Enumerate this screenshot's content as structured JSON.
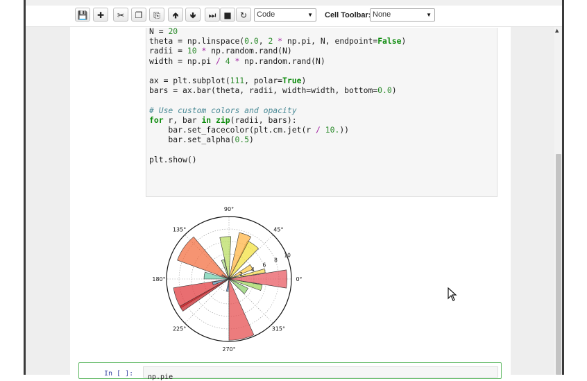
{
  "toolbar": {
    "buttons": [
      {
        "name": "save-button",
        "icon": "save-icon",
        "glyph": "💾"
      },
      {
        "name": "insert-cell-button",
        "icon": "plus-icon",
        "glyph": "✚"
      },
      {
        "name": "cut-button",
        "icon": "scissors-icon",
        "glyph": "✂"
      },
      {
        "name": "copy-button",
        "icon": "copy-icon",
        "glyph": "❐"
      },
      {
        "name": "paste-button",
        "icon": "paste-icon",
        "glyph": "⎘"
      },
      {
        "name": "move-up-button",
        "icon": "arrow-up-icon",
        "glyph": "🢁"
      },
      {
        "name": "move-down-button",
        "icon": "arrow-down-icon",
        "glyph": "🢃"
      },
      {
        "name": "run-button",
        "icon": "step-forward-icon",
        "glyph": "⏭"
      },
      {
        "name": "interrupt-button",
        "icon": "stop-icon",
        "glyph": "■"
      },
      {
        "name": "restart-button",
        "icon": "refresh-icon",
        "glyph": "↻"
      }
    ],
    "cell_type": "Code",
    "cell_toolbar_label": "Cell Toolbar:",
    "cell_toolbar_value": "None"
  },
  "code_lines": [
    [
      {
        "t": "N = "
      },
      {
        "t": "20",
        "c": "num"
      }
    ],
    [
      {
        "t": "theta = np.linspace("
      },
      {
        "t": "0.0",
        "c": "num"
      },
      {
        "t": ", "
      },
      {
        "t": "2",
        "c": "num"
      },
      {
        "t": " "
      },
      {
        "t": "*",
        "c": "op"
      },
      {
        "t": " np.pi, N, endpoint="
      },
      {
        "t": "False",
        "c": "kw"
      },
      {
        "t": ")"
      }
    ],
    [
      {
        "t": "radii = "
      },
      {
        "t": "10",
        "c": "num"
      },
      {
        "t": " "
      },
      {
        "t": "*",
        "c": "op"
      },
      {
        "t": " np.random.rand(N)"
      }
    ],
    [
      {
        "t": "width = np.pi "
      },
      {
        "t": "/",
        "c": "op"
      },
      {
        "t": " "
      },
      {
        "t": "4",
        "c": "num"
      },
      {
        "t": " "
      },
      {
        "t": "*",
        "c": "op"
      },
      {
        "t": " np.random.rand(N)"
      }
    ],
    [],
    [
      {
        "t": "ax = plt.subplot("
      },
      {
        "t": "111",
        "c": "num"
      },
      {
        "t": ", polar="
      },
      {
        "t": "True",
        "c": "kw"
      },
      {
        "t": ")"
      }
    ],
    [
      {
        "t": "bars = ax.bar(theta, radii, width=width, bottom="
      },
      {
        "t": "0.0",
        "c": "num"
      },
      {
        "t": ")"
      }
    ],
    [],
    [
      {
        "t": "# Use custom colors and opacity",
        "c": "cm"
      }
    ],
    [
      {
        "t": "for",
        "c": "kw"
      },
      {
        "t": " r, bar "
      },
      {
        "t": "in",
        "c": "kw"
      },
      {
        "t": " "
      },
      {
        "t": "zip",
        "c": "kw"
      },
      {
        "t": "(radii, bars):"
      }
    ],
    [
      {
        "t": "    bar.set_facecolor(plt.cm.jet(r "
      },
      {
        "t": "/",
        "c": "op"
      },
      {
        "t": " "
      },
      {
        "t": "10.",
        "c": "num"
      },
      {
        "t": "))"
      }
    ],
    [
      {
        "t": "    bar.set_alpha("
      },
      {
        "t": "0.5",
        "c": "num"
      },
      {
        "t": ")"
      }
    ],
    [],
    [
      {
        "t": "plt.show()"
      }
    ]
  ],
  "chart_data": {
    "type": "polar-bar",
    "angle_ticks": [
      "0°",
      "45°",
      "90°",
      "135°",
      "180°",
      "225°",
      "270°",
      "315°"
    ],
    "radial_ticks": [
      "2",
      "4",
      "6",
      "8",
      "10"
    ],
    "rlim": [
      0,
      10
    ],
    "bars": [
      {
        "theta_deg": 0,
        "width_deg": 18,
        "r": 9.3,
        "color": "#e8545d"
      },
      {
        "theta_deg": 18,
        "width_deg": 10,
        "r": 1.2,
        "color": "#5fc7ee"
      },
      {
        "theta_deg": 28,
        "width_deg": 12,
        "r": 4.1,
        "color": "#ffcc44"
      },
      {
        "theta_deg": 55,
        "width_deg": 18,
        "r": 6.8,
        "color": "#f2e03a"
      },
      {
        "theta_deg": 70,
        "width_deg": 15,
        "r": 7.6,
        "color": "#ffb340"
      },
      {
        "theta_deg": 95,
        "width_deg": 15,
        "r": 6.8,
        "color": "#b8dc5e"
      },
      {
        "theta_deg": 108,
        "width_deg": 8,
        "r": 3.2,
        "color": "#a7d880"
      },
      {
        "theta_deg": 145,
        "width_deg": 30,
        "r": 8.8,
        "color": "#f26b3c"
      },
      {
        "theta_deg": 150,
        "width_deg": 5,
        "r": 1.3,
        "color": "#4aa8e6"
      },
      {
        "theta_deg": 172,
        "width_deg": 16,
        "r": 4.0,
        "color": "#6ccfad"
      },
      {
        "theta_deg": 200,
        "width_deg": 22,
        "r": 9.0,
        "color": "#e0363a"
      },
      {
        "theta_deg": 212,
        "width_deg": 6,
        "r": 9.0,
        "color": "#c41f24"
      },
      {
        "theta_deg": 196,
        "width_deg": 10,
        "r": 2.7,
        "color": "#5bc0e0"
      },
      {
        "theta_deg": 262,
        "width_deg": 8,
        "r": 2.0,
        "color": "#4f90e0"
      },
      {
        "theta_deg": 282,
        "width_deg": 24,
        "r": 9.8,
        "color": "#e5494b"
      },
      {
        "theta_deg": 325,
        "width_deg": 18,
        "r": 3.4,
        "color": "#8ad06a"
      },
      {
        "theta_deg": 345,
        "width_deg": 10,
        "r": 5.4,
        "color": "#9fd65a"
      },
      {
        "theta_deg": 13,
        "width_deg": 6,
        "r": 5.9,
        "color": "#f5d94a"
      }
    ]
  },
  "next_cell": {
    "prompt": "In [ ]:",
    "code": "np.pie"
  }
}
